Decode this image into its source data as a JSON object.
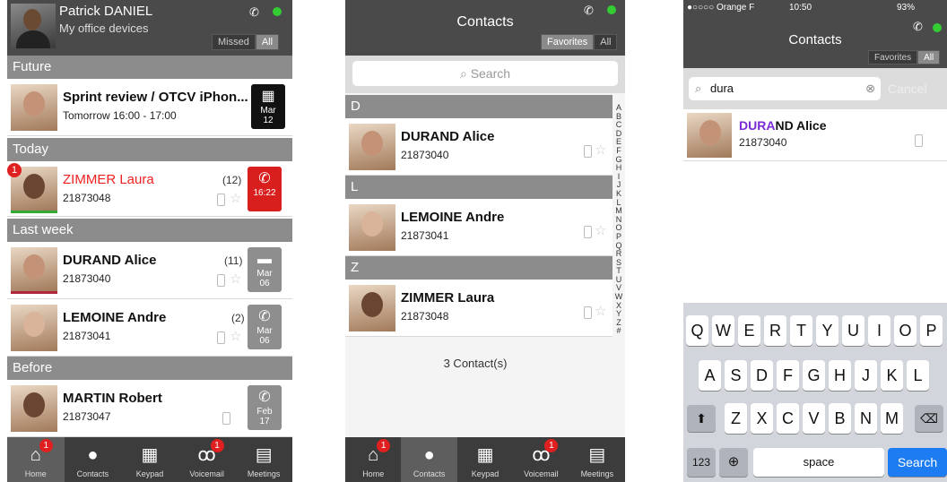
{
  "screen1": {
    "user_name": "Patrick DANIEL",
    "user_subtitle": "My office devices",
    "filter": {
      "missed": "Missed",
      "all": "All"
    },
    "sections": {
      "future": "Future",
      "today": "Today",
      "last_week": "Last week",
      "before": "Before"
    },
    "rows": [
      {
        "name": "Sprint review / OTCV iPhon...",
        "sub": "Tomorrow 16:00 - 17:00",
        "tile_top": "Mar",
        "tile_bottom": "12"
      },
      {
        "name": "ZIMMER Laura",
        "sub": "21873048",
        "count": "(12)",
        "badge": "1",
        "tile_time": "16:22"
      },
      {
        "name": "DURAND Alice",
        "sub": "21873040",
        "count": "(11)",
        "tile_top": "Mar",
        "tile_bottom": "06"
      },
      {
        "name": "LEMOINE Andre",
        "sub": "21873041",
        "count": "(2)",
        "tile_top": "Mar",
        "tile_bottom": "06"
      },
      {
        "name": "MARTIN Robert",
        "sub": "21873047",
        "tile_top": "Feb",
        "tile_bottom": "17"
      }
    ],
    "tabs": [
      {
        "label": "Home",
        "badge": "1"
      },
      {
        "label": "Contacts"
      },
      {
        "label": "Keypad"
      },
      {
        "label": "Voicemail",
        "badge": "1"
      },
      {
        "label": "Meetings"
      }
    ]
  },
  "screen2": {
    "title": "Contacts",
    "filter": {
      "favorites": "Favorites",
      "all": "All"
    },
    "search_placeholder": "Search",
    "sections": {
      "d": "D",
      "l": "L",
      "z": "Z"
    },
    "contacts": [
      {
        "name": "DURAND Alice",
        "number": "21873040"
      },
      {
        "name": "LEMOINE Andre",
        "number": "21873041"
      },
      {
        "name": "ZIMMER Laura",
        "number": "21873048"
      }
    ],
    "count_label": "3 Contact(s)",
    "alphabet": [
      "A",
      "B",
      "C",
      "D",
      "E",
      "F",
      "G",
      "H",
      "I",
      "J",
      "K",
      "L",
      "M",
      "N",
      "O",
      "P",
      "Q",
      "R",
      "S",
      "T",
      "U",
      "V",
      "W",
      "X",
      "Y",
      "Z",
      "#"
    ],
    "tabs": [
      {
        "label": "Home",
        "badge": "1"
      },
      {
        "label": "Contacts"
      },
      {
        "label": "Keypad"
      },
      {
        "label": "Voicemail",
        "badge": "1"
      },
      {
        "label": "Meetings"
      }
    ]
  },
  "screen3": {
    "carrier": "●○○○○ Orange F",
    "time": "10:50",
    "battery": "93%",
    "title": "Contacts",
    "filter": {
      "favorites": "Favorites",
      "all": "All"
    },
    "search_value": "dura",
    "cancel_label": "Cancel",
    "result": {
      "match": "DURA",
      "rest": "ND Alice",
      "number": "21873040"
    },
    "keyboard": {
      "row1": [
        "Q",
        "W",
        "E",
        "R",
        "T",
        "Y",
        "U",
        "I",
        "O",
        "P"
      ],
      "row2": [
        "A",
        "S",
        "D",
        "F",
        "G",
        "H",
        "J",
        "K",
        "L"
      ],
      "row3": [
        "Z",
        "X",
        "C",
        "V",
        "B",
        "N",
        "M"
      ],
      "numbers_label": "123",
      "space_label": "space",
      "search_label": "Search"
    }
  },
  "colors": {
    "header": "#4a4a4a",
    "section": "#8c8c8c",
    "badge": "#e02020",
    "missed": "#d91e1e",
    "status": "#33cc33",
    "search_key": "#1e7cf2"
  }
}
